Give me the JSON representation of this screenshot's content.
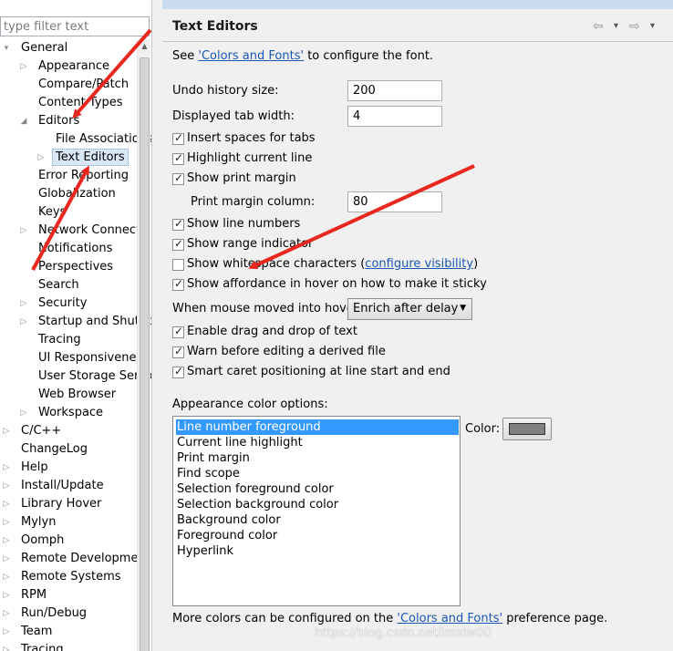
{
  "filter": {
    "placeholder": "type filter text"
  },
  "tree": [
    {
      "label": "General",
      "depth": 0,
      "expander": "▾",
      "row": 0
    },
    {
      "label": "Appearance",
      "depth": 1,
      "expander": "▷",
      "row": 1
    },
    {
      "label": "Compare/Patch",
      "depth": 1,
      "expander": "",
      "row": 2
    },
    {
      "label": "Content Types",
      "depth": 1,
      "expander": "",
      "row": 3
    },
    {
      "label": "Editors",
      "depth": 1,
      "expander": "◢",
      "row": 4
    },
    {
      "label": "File Associations",
      "depth": 2,
      "expander": "",
      "row": 5
    },
    {
      "label": "Text Editors",
      "depth": 2,
      "expander": "▷",
      "row": 6,
      "selected": true
    },
    {
      "label": "Error Reporting",
      "depth": 1,
      "expander": "",
      "row": 7
    },
    {
      "label": "Globalization",
      "depth": 1,
      "expander": "",
      "row": 8
    },
    {
      "label": "Keys",
      "depth": 1,
      "expander": "",
      "row": 9
    },
    {
      "label": "Network Connections",
      "depth": 1,
      "expander": "▷",
      "row": 10
    },
    {
      "label": "Notifications",
      "depth": 1,
      "expander": "",
      "row": 11
    },
    {
      "label": "Perspectives",
      "depth": 1,
      "expander": "",
      "row": 12
    },
    {
      "label": "Search",
      "depth": 1,
      "expander": "",
      "row": 13
    },
    {
      "label": "Security",
      "depth": 1,
      "expander": "▷",
      "row": 14
    },
    {
      "label": "Startup and Shutdown",
      "depth": 1,
      "expander": "▷",
      "row": 15
    },
    {
      "label": "Tracing",
      "depth": 1,
      "expander": "",
      "row": 16
    },
    {
      "label": "UI Responsiveness",
      "depth": 1,
      "expander": "",
      "row": 17
    },
    {
      "label": "User Storage Service",
      "depth": 1,
      "expander": "",
      "row": 18
    },
    {
      "label": "Web Browser",
      "depth": 1,
      "expander": "",
      "row": 19
    },
    {
      "label": "Workspace",
      "depth": 1,
      "expander": "▷",
      "row": 20
    },
    {
      "label": "C/C++",
      "depth": 0,
      "expander": "▷",
      "row": 21
    },
    {
      "label": "ChangeLog",
      "depth": 0,
      "expander": "",
      "row": 22
    },
    {
      "label": "Help",
      "depth": 0,
      "expander": "▷",
      "row": 23
    },
    {
      "label": "Install/Update",
      "depth": 0,
      "expander": "▷",
      "row": 24
    },
    {
      "label": "Library Hover",
      "depth": 0,
      "expander": "▷",
      "row": 25
    },
    {
      "label": "Mylyn",
      "depth": 0,
      "expander": "▷",
      "row": 26
    },
    {
      "label": "Oomph",
      "depth": 0,
      "expander": "▷",
      "row": 27
    },
    {
      "label": "Remote Development",
      "depth": 0,
      "expander": "▷",
      "row": 28
    },
    {
      "label": "Remote Systems",
      "depth": 0,
      "expander": "▷",
      "row": 29
    },
    {
      "label": "RPM",
      "depth": 0,
      "expander": "▷",
      "row": 30
    },
    {
      "label": "Run/Debug",
      "depth": 0,
      "expander": "▷",
      "row": 31
    },
    {
      "label": "Team",
      "depth": 0,
      "expander": "▷",
      "row": 32
    },
    {
      "label": "Tracing",
      "depth": 0,
      "expander": "▷",
      "row": 33
    }
  ],
  "page": {
    "title": "Text Editors",
    "intro_prefix": "See ",
    "intro_link": "'Colors and Fonts'",
    "intro_suffix": " to configure the font.",
    "undo_label": "Undo history size:",
    "undo_value": "200",
    "tab_label": "Displayed tab width:",
    "tab_value": "4",
    "print_margin_label": "Print margin column:",
    "print_margin_value": "80",
    "hover_label": "When mouse moved into hover:",
    "hover_value": "Enrich after delay",
    "whitespace_prefix": "Show whitespace characters (",
    "whitespace_link": "configure visibility",
    "whitespace_suffix": ")",
    "appearance_label": "Appearance color options:",
    "color_label": "Color:",
    "swatch_color": "#808080",
    "footer_prefix": "More colors can be configured on the ",
    "footer_link": "'Colors and Fonts'",
    "footer_suffix": " preference page."
  },
  "checkboxes": [
    {
      "label": "Insert spaces for tabs",
      "checked": true
    },
    {
      "label": "Highlight current line",
      "checked": true
    },
    {
      "label": "Show print margin",
      "checked": true
    },
    {
      "label": "Show line numbers",
      "checked": true
    },
    {
      "label": "Show range indicator",
      "checked": true
    },
    {
      "label": "Show whitespace characters",
      "checked": false
    },
    {
      "label": "Show affordance in hover on how to make it sticky",
      "checked": true
    },
    {
      "label": "Enable drag and drop of text",
      "checked": true
    },
    {
      "label": "Warn before editing a derived file",
      "checked": true
    },
    {
      "label": "Smart caret positioning at line start and end",
      "checked": true
    }
  ],
  "color_options": [
    "Line number foreground",
    "Current line highlight",
    "Print margin",
    "Find scope",
    "Selection foreground color",
    "Selection background color",
    "Background color",
    "Foreground color",
    "Hyperlink"
  ],
  "selected_color_option": 0,
  "watermark": "https://blog.csdn.net/imxlw00",
  "annotation_arrow_color": "#e8281e"
}
